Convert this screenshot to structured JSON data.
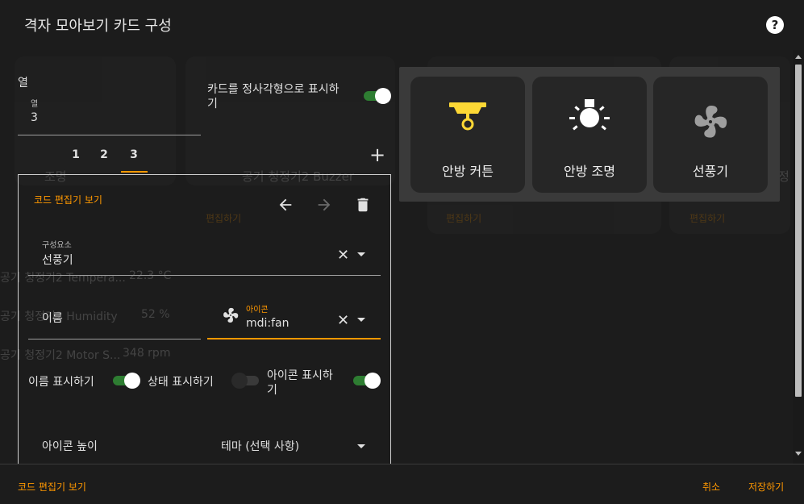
{
  "dialog": {
    "title": "격자 모아보기 카드 구성",
    "help_icon": "help-circle-icon"
  },
  "background": {
    "card1_name": "조명",
    "card2_name": "공기 청정기2 Buzzer",
    "edit_label_1": "편집하기",
    "edit_label_2": "편집하기",
    "edit_label_3": "편집하기",
    "row1": {
      "name": "공기 청정기2 Tempera...",
      "value": "22.3 °C"
    },
    "row2": {
      "name": "공기 청정기2 Humidity",
      "value": "52 %"
    },
    "row3": {
      "name": "공기 청정기2 Motor S...",
      "value": "348 rpm"
    },
    "side_label": "정"
  },
  "editor": {
    "columns_heading": "열",
    "columns_field": {
      "label": "열",
      "value": "3"
    },
    "square_label_line1": "카드를 정사각형으로 표시하",
    "square_label_line2": "기",
    "square_toggle": true,
    "tabs": [
      "1",
      "2",
      "3"
    ],
    "active_tab": "3",
    "add_icon": "plus-icon",
    "code_editor_link": "코드 편집기 보기",
    "back_icon": "arrow-left-icon",
    "forward_icon": "arrow-right-icon",
    "delete_icon": "trash-icon",
    "component_field": {
      "label": "구성요소",
      "value": "선풍기"
    },
    "name_field": {
      "label": "이름",
      "value": ""
    },
    "icon_field": {
      "label": "아이콘",
      "value": "mdi:fan",
      "icon": "fan-icon"
    },
    "show_name": {
      "label": "이름 표시하기",
      "on": true
    },
    "show_state": {
      "label": "상태 표시하기",
      "on": false
    },
    "show_icon": {
      "label_line1": "아이콘 표시하",
      "label_line2": "기",
      "on": true
    },
    "icon_height_label": "아이콘 높이",
    "theme_select": {
      "label": "테마 (선택 사항)"
    }
  },
  "preview": {
    "cards": [
      {
        "name": "안방 커튼",
        "icon": "ceiling-fixture-icon",
        "color": "#fdd835"
      },
      {
        "name": "안방 조명",
        "icon": "lightbulb-on-icon",
        "color": "#ffffff"
      },
      {
        "name": "선풍기",
        "icon": "fan-icon",
        "color": "#9e9e9e"
      }
    ]
  },
  "footer": {
    "code_editor_label": "코드 편집기 보기",
    "cancel_label": "취소",
    "save_label": "저장하기"
  },
  "colors": {
    "accent": "#ff9800",
    "toggle_on": "#2e7d32",
    "dialog_bg": "#1c1c1c"
  }
}
